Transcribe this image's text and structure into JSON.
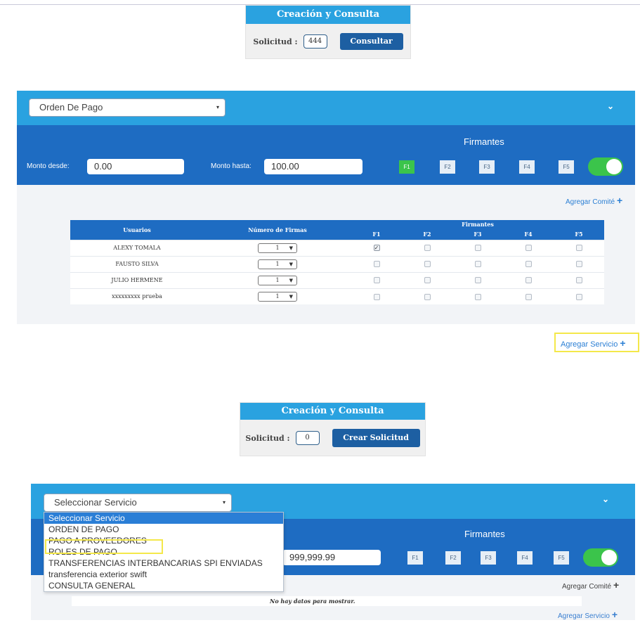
{
  "top_box": {
    "title": "Creación y Consulta",
    "solicitud_label": "Solicitud :",
    "solicitud_value": "444",
    "button": "Consultar"
  },
  "panel1": {
    "service_select": "Orden De Pago",
    "firmantes_title": "Firmantes",
    "monto_desde_label": "Monto desde:",
    "monto_desde_value": "0.00",
    "monto_hasta_label": "Monto hasta:",
    "monto_hasta_value": "100.00",
    "f_buttons": [
      "F1",
      "F2",
      "F3",
      "F4",
      "F5"
    ],
    "active_f": "F1",
    "toggle_on": true,
    "agregar_comite": "Agregar Comité",
    "table": {
      "headers": {
        "usuarios": "Usuarios",
        "numero_firmas": "Número de Firmas",
        "firmantes": "Firmantes",
        "f_cols": [
          "F1",
          "F2",
          "F3",
          "F4",
          "F5"
        ]
      },
      "rows": [
        {
          "usuario": "ALEXY TOMALA",
          "firmas": "1",
          "checks": [
            true,
            false,
            false,
            false,
            false
          ]
        },
        {
          "usuario": "FAUSTO SILVA",
          "firmas": "1",
          "checks": [
            false,
            false,
            false,
            false,
            false
          ]
        },
        {
          "usuario": "JULIO HERMENE",
          "firmas": "1",
          "checks": [
            false,
            false,
            false,
            false,
            false
          ]
        },
        {
          "usuario": "xxxxxxxxx prueba",
          "firmas": "1",
          "checks": [
            false,
            false,
            false,
            false,
            false
          ]
        }
      ]
    },
    "agregar_servicio": "Agregar Servicio"
  },
  "mid_box": {
    "title": "Creación y Consulta",
    "solicitud_label": "Solicitud :",
    "solicitud_value": "0",
    "button": "Crear Solicitud"
  },
  "panel2": {
    "service_select": "Seleccionar Servicio",
    "dropdown_options": [
      "Seleccionar Servicio",
      "ORDEN DE PAGO",
      "PAGO A PROVEEDORES",
      "ROLES DE PAGO",
      "TRANSFERENCIAS INTERBANCARIAS SPI ENVIADAS",
      "transferencia exterior swift",
      "CONSULTA GENERAL"
    ],
    "selected_option": "Seleccionar Servicio",
    "highlighted_option": "PAGO A PROVEEDORES",
    "firmantes_title": "Firmantes",
    "monto_hasta_value": "999,999.99",
    "f_buttons": [
      "F1",
      "F2",
      "F3",
      "F4",
      "F5"
    ],
    "toggle_on": true,
    "agregar_comite": "Agregar Comité",
    "no_data": "No hay datos para mostrar.",
    "agregar_servicio": "Agregar Servicio"
  },
  "colors": {
    "header_blue": "#2aa2e0",
    "dark_blue": "#1e6cc2",
    "button_blue": "#1d5fa2",
    "green": "#3bc44b",
    "highlight_yellow": "#f4e84a"
  }
}
